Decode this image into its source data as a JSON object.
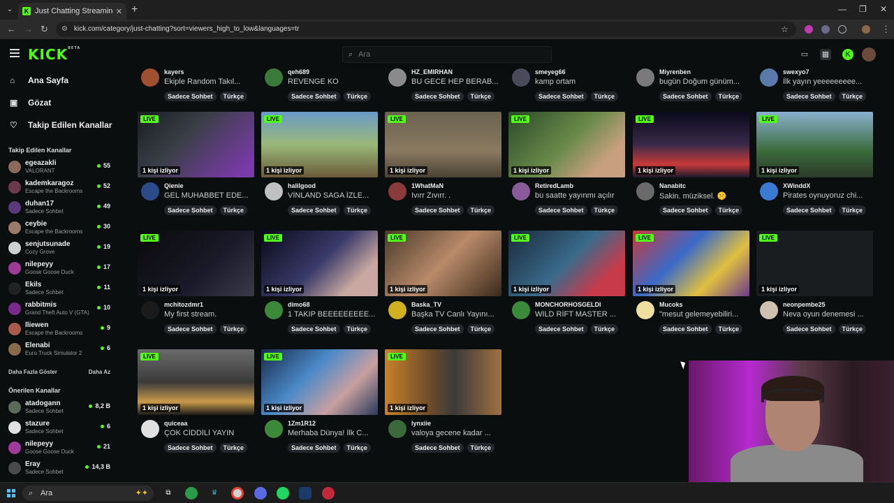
{
  "browser": {
    "tab_title": "Just Chatting Streaming - Live S",
    "url": "kick.com/category/just-chatting?sort=viewers_high_to_low&languages=tr"
  },
  "header": {
    "logo": "KICK",
    "logo_badge": "BETA",
    "search_placeholder": "Ara"
  },
  "sidebar": {
    "nav": [
      {
        "label": "Ana Sayfa",
        "icon": "home-icon"
      },
      {
        "label": "Gözat",
        "icon": "browse-icon"
      },
      {
        "label": "Takip Edilen Kanallar",
        "icon": "heart-icon"
      }
    ],
    "followed_title": "Takip Edilen Kanallar",
    "followed": [
      {
        "name": "egeazakli",
        "category": "VALORANT",
        "viewers": "55",
        "color": "#8a6a5a"
      },
      {
        "name": "kademkaragoz",
        "category": "Escape the Backrooms",
        "viewers": "52",
        "color": "#6a3a4a"
      },
      {
        "name": "duhan17",
        "category": "Sadece Sohbet",
        "viewers": "49",
        "color": "#5a3a7a"
      },
      {
        "name": "ceybie",
        "category": "Escape the Backrooms",
        "viewers": "30",
        "color": "#9a7a6a"
      },
      {
        "name": "senjutsunade",
        "category": "Cozy Grove",
        "viewers": "19",
        "color": "#d0d0d0"
      },
      {
        "name": "nilepeyy",
        "category": "Goose Goose Duck",
        "viewers": "17",
        "color": "#a03a9a"
      },
      {
        "name": "Ekils",
        "category": "Sadece Sohbet",
        "viewers": "11",
        "color": "#222222"
      },
      {
        "name": "rabbitmis",
        "category": "Grand Theft Auto V (GTA)",
        "viewers": "10",
        "color": "#7a2a8a"
      },
      {
        "name": "lliewen",
        "category": "Escape the Backrooms",
        "viewers": "9",
        "color": "#aa5a4a"
      },
      {
        "name": "Elenabi",
        "category": "Euro Truck Simulator 2",
        "viewers": "6",
        "color": "#8a6a4a"
      }
    ],
    "show_more": "Daha Fazla Göster",
    "show_less": "Daha Az",
    "recommended_title": "Önerilen Kanallar",
    "recommended": [
      {
        "name": "atadogann",
        "category": "Sadece Sohbet",
        "viewers": "8,2 B",
        "color": "#5a6a5a"
      },
      {
        "name": "stazure",
        "category": "Sadece Sohbet",
        "viewers": "6",
        "color": "#e0e0e0"
      },
      {
        "name": "nilepeyy",
        "category": "Goose Goose Duck",
        "viewers": "21",
        "color": "#a03a9a"
      },
      {
        "name": "Eray",
        "category": "Sadece Sohbet",
        "viewers": "14,3 B",
        "color": "#4a4a4a"
      }
    ]
  },
  "top_row": [
    {
      "name": "kayers",
      "title": "Ekiple Random Takıl...",
      "color": "#a05030"
    },
    {
      "name": "qeh689",
      "title": "REVENGE KO",
      "color": "#3a7a3a"
    },
    {
      "name": "HZ_EMIRHAN",
      "title": "BU GECE HEP BERAB...",
      "color": "#8a8a8a"
    },
    {
      "name": "smeyeg66",
      "title": "kamp ortam",
      "color": "#4a4a5a"
    },
    {
      "name": "Miyrenben",
      "title": "bugün Doğum günüm...",
      "color": "#7a7a7a"
    },
    {
      "name": "swexyo7",
      "title": "İlk yayın yeeeeeeeee...",
      "color": "#5a7aaa"
    }
  ],
  "cards": [
    {
      "name": "Qienie",
      "title": "GEL MUHABBET EDE...",
      "viewers": "1 kişi izliyor",
      "thumb": "linear-gradient(135deg,#1a1d22,#3a3f48 40%,#7a3aa8 90%)",
      "avatar": "#2a4a8a"
    },
    {
      "name": "halilgood",
      "title": "VİNLAND SAGA İZLE...",
      "viewers": "1 kişi izliyor",
      "thumb": "linear-gradient(180deg,#6a9ac8 0%,#9ab878 50%,#6a5a3a 100%)",
      "avatar": "#c0c0c0"
    },
    {
      "name": "1WhatMaN",
      "title": "Ivırr Zıvırr. .",
      "viewers": "1 kişi izliyor",
      "thumb": "linear-gradient(180deg,#6a6250 0%,#8a7a60 60%,#4a4234 100%)",
      "avatar": "#8a3a3a"
    },
    {
      "name": "RetiredLamb",
      "title": "bu saatte yayınmı açılır",
      "viewers": "1 kişi izliyor",
      "thumb": "linear-gradient(135deg,#2a4a2a,#6a8a4a 50%,#c8a080 80%)",
      "avatar": "#8a5a9a"
    },
    {
      "name": "Nanabitc",
      "title": "Sakin. müziksel. 🤫",
      "viewers": "1 kişi izliyor",
      "thumb": "linear-gradient(180deg,#0a0a1a 0%,#3a2a4a 50%,#c83a3a 80%,#1a1a2a 100%)",
      "avatar": "#6a6a6a"
    },
    {
      "name": "XWinddX",
      "title": "Pirates oynuyoruz chi...",
      "viewers": "1 kişi izliyor",
      "thumb": "linear-gradient(180deg,#8ab0d0 0%,#3a6a3a 60%,#2a3a2a 100%)",
      "avatar": "#3a7ad0"
    },
    {
      "name": "mchitozdmr1",
      "title": "My first stream.",
      "viewers": "1 kişi izliyor",
      "thumb": "linear-gradient(135deg,#0a0a0a,#1a1a2a 60%,#3a3a4a)",
      "avatar": "#1a1a1a"
    },
    {
      "name": "dimo68",
      "title": "1 TAKIP BEEEEEEEEE...",
      "viewers": "1 kişi izliyor",
      "thumb": "linear-gradient(135deg,#0a0a1a,#3a3a6a 50%,#c8a8a0 80%)",
      "avatar": "#3a8a3a"
    },
    {
      "name": "Baska_TV",
      "title": "Başka TV Canlı Yayını...",
      "viewers": "1 kişi izliyor",
      "thumb": "linear-gradient(135deg,#4a3a2a,#b88a6a 50%,#3a2a1a)",
      "avatar": "#d0b020"
    },
    {
      "name": "MONCHORHOSGELDI",
      "title": "WİLD RİFT MASTER ...",
      "viewers": "1 kişi izliyor",
      "thumb": "linear-gradient(135deg,#1a2a3a,#3a6a8a 50%,#c83a4a 80%)",
      "avatar": "#3a8a3a"
    },
    {
      "name": "Mucoks",
      "title": "\"mesut gelemeyebiliri...",
      "viewers": "1 kişi izliyor",
      "thumb": "linear-gradient(135deg,#c83a3a,#3a6ac8 40%,#e0c040 70%,#6a3a8a)",
      "avatar": "#f0e0a0"
    },
    {
      "name": "neonpembe25",
      "title": "Neva oyun denemesi ...",
      "viewers": "1 kişi izliyor",
      "thumb": "linear-gradient(180deg,#1a1d20,#1a1d20)",
      "avatar": "#d0c0b0"
    },
    {
      "name": "quiceaa",
      "title": "ÇOK CİDDİLİ YAYIN",
      "viewers": "1 kişi izliyor",
      "thumb": "linear-gradient(180deg,#6a6a6a 0%,#3a3a3a 50%,#c89a4a 80%,#1a1a1a)",
      "avatar": "#e0e0e0"
    },
    {
      "name": "1Zm1R12",
      "title": "Merhaba Dünya! İlk C...",
      "viewers": "1 kişi izliyor",
      "thumb": "linear-gradient(135deg,#1a2a4a,#4a8ac8 40%,#c8a0a0 70%,#2a3a5a)",
      "avatar": "#3a8a3a"
    },
    {
      "name": "lynxiie",
      "title": "valoya gecene kadar ...",
      "viewers": "1 kişi izliyor",
      "thumb": "linear-gradient(90deg,#c8822a 0%,#6a4a2a 40%,#3a3a3a 60%,#a07040 100%)",
      "avatar": "#3a6a3a"
    }
  ],
  "tag_labels": [
    "Sadece Sohbet",
    "Türkçe"
  ],
  "live_label": "LIVE",
  "taskbar": {
    "search_label": "Ara"
  }
}
